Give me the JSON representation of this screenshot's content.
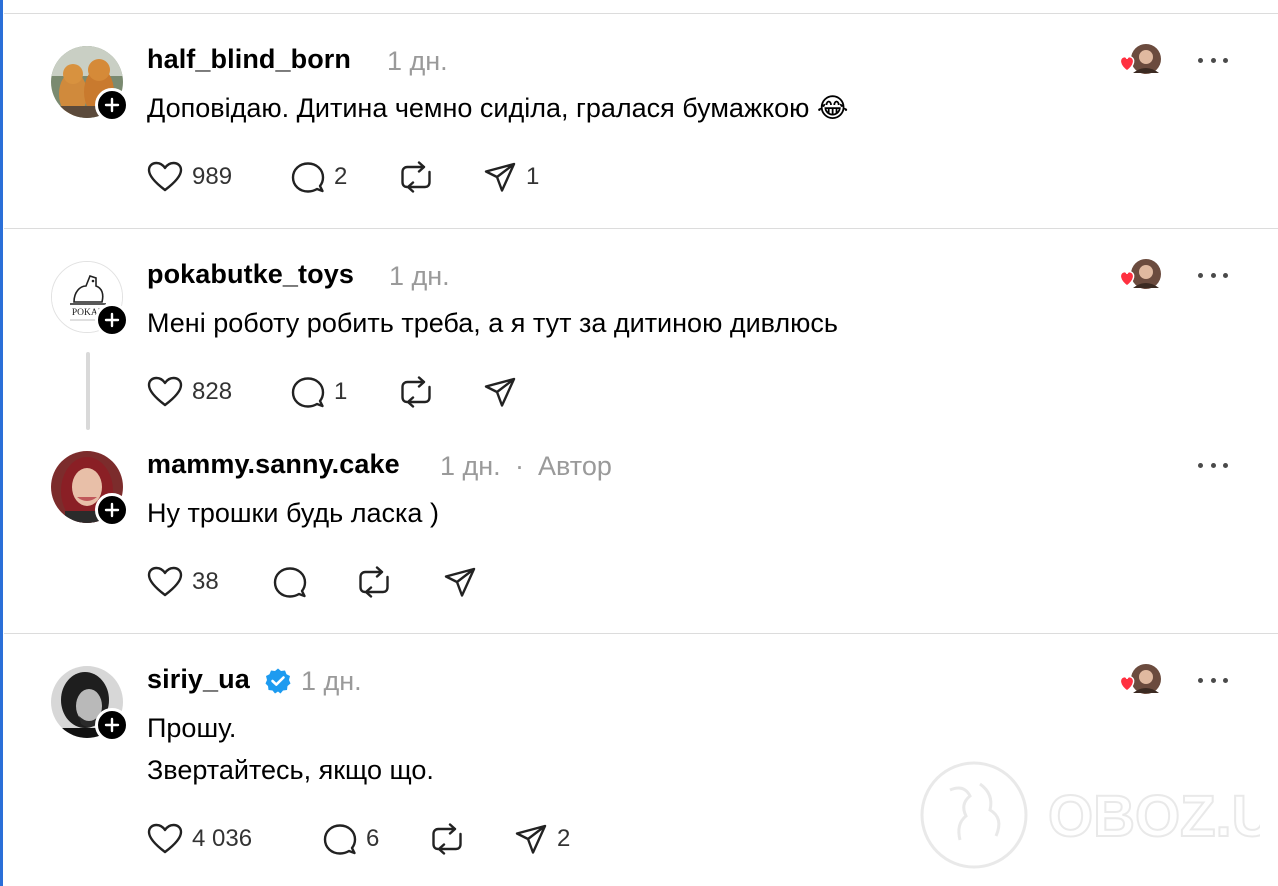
{
  "posts": [
    {
      "username": "half_blind_born",
      "time": "1 дн.",
      "text_lines": [
        "Доповідаю. Дитина чемно сиділа, гралася бумажкою 😂"
      ],
      "likes": "989",
      "replies": "2",
      "shares": "1",
      "liked_by_author": true,
      "avatar_icon": "cats-avatar"
    },
    {
      "username": "pokabutke_toys",
      "time": "1 дн.",
      "text_lines": [
        "Мені роботу робить треба, а я тут за дитиною дивлюсь"
      ],
      "likes": "828",
      "replies": "1",
      "shares": "",
      "liked_by_author": true,
      "avatar_icon": "dino-logo-avatar",
      "avatar_text": "POKAB"
    },
    {
      "username": "mammy.sanny.cake",
      "time": "1 дн.",
      "separator": "·",
      "badge": "Автор",
      "text_lines": [
        "Ну трошки будь ласка )"
      ],
      "likes": "38",
      "replies": "",
      "shares": "",
      "liked_by_author": false,
      "avatar_icon": "woman-avatar"
    },
    {
      "username": "siriy_ua",
      "verified": true,
      "time": "1 дн.",
      "text_lines": [
        "Прошу.",
        "Звертайтесь, якщо що."
      ],
      "likes": "4 036",
      "replies": "6",
      "shares": "2",
      "liked_by_author": true,
      "avatar_icon": "man-avatar"
    }
  ],
  "watermark": "OBOZ.UA",
  "colors": {
    "heart": "#ff3040",
    "verified": "#1d9bf0",
    "meta": "#9a9a9a",
    "frame": "#2a6fd8"
  }
}
